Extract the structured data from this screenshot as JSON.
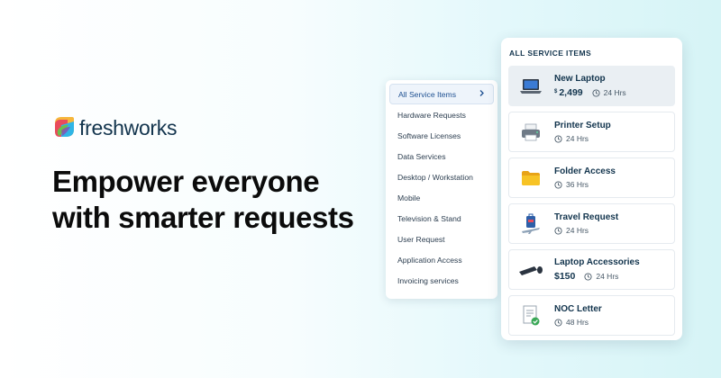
{
  "brand": {
    "name": "freshworks"
  },
  "headline": {
    "line1": "Empower everyone",
    "line2": "with smarter requests"
  },
  "categories": {
    "items": [
      {
        "label": "All Service Items",
        "active": true
      },
      {
        "label": "Hardware Requests"
      },
      {
        "label": "Software Licenses"
      },
      {
        "label": "Data Services"
      },
      {
        "label": "Desktop / Workstation"
      },
      {
        "label": "Mobile"
      },
      {
        "label": "Television & Stand"
      },
      {
        "label": "User Request"
      },
      {
        "label": "Application Access"
      },
      {
        "label": "Invoicing services"
      }
    ],
    "chevron_icon": "chevron-right-icon"
  },
  "services": {
    "header": "ALL SERVICE ITEMS",
    "items": [
      {
        "title": "New Laptop",
        "currency": "$",
        "price": "2,499",
        "time": "24 Hrs",
        "icon": "laptop-icon"
      },
      {
        "title": "Printer Setup",
        "time": "24 Hrs",
        "icon": "printer-icon"
      },
      {
        "title": "Folder Access",
        "time": "36 Hrs",
        "icon": "folder-icon"
      },
      {
        "title": "Travel Request",
        "time": "24 Hrs",
        "icon": "travel-icon"
      },
      {
        "title": "Laptop Accessories",
        "price": "$150",
        "time": "24 Hrs",
        "icon": "keyboard-mouse-icon"
      },
      {
        "title": "NOC Letter",
        "time": "48 Hrs",
        "icon": "certificate-icon"
      }
    ]
  },
  "colors": {
    "brand_navy": "#12344d",
    "accent_blue": "#1d4f91",
    "bg_teal": "#d6f4f6"
  }
}
